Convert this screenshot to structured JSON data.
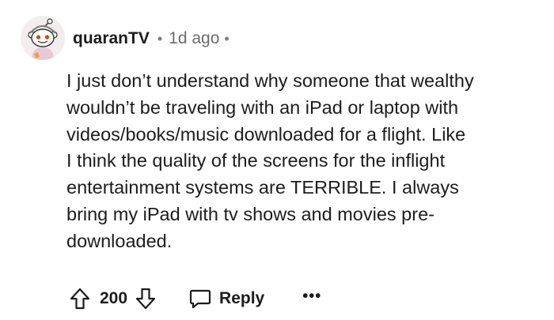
{
  "comment": {
    "author": "quaranTV",
    "separator": "•",
    "timestamp": "1d ago",
    "avatar_icon": "snoo-avatar-icon",
    "body_lines": [
      "I just don’t understand why someone that wealthy",
      "wouldn’t be traveling with an iPad or laptop with",
      "videos/books/music downloaded for a flight. Like",
      "I think the quality of the screens for the inflight",
      "entertainment systems are TERRIBLE. I always",
      "bring my iPad with tv shows and movies pre-",
      "downloaded."
    ]
  },
  "actions": {
    "upvote_icon": "arrow-up-icon",
    "score": "200",
    "downvote_icon": "arrow-down-icon",
    "reply_icon": "speech-bubble-icon",
    "reply_label": "Reply",
    "more_label": "•••"
  },
  "colors": {
    "text": "#1c1c1c",
    "meta": "#6b6b6b",
    "avatar_bg": "#f1ecec"
  }
}
